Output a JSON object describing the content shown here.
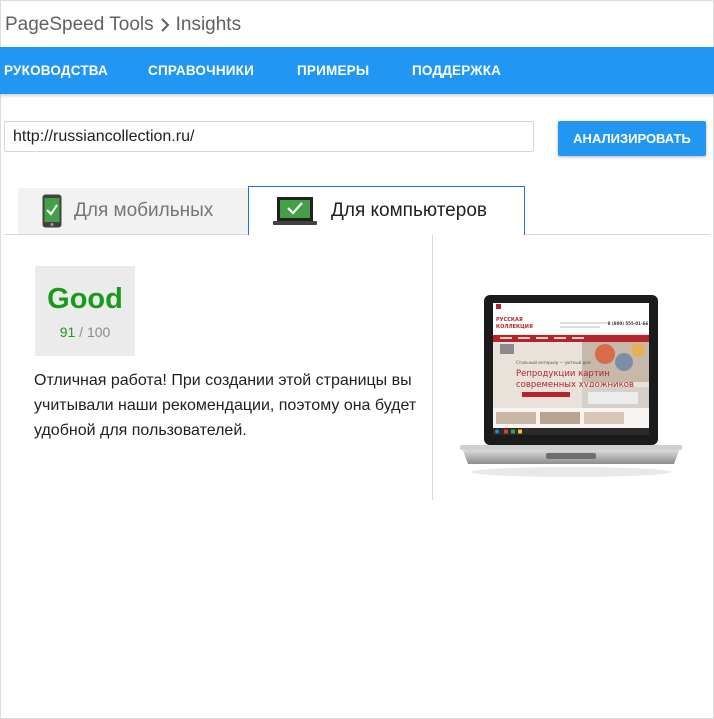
{
  "breadcrumb": {
    "root": "PageSpeed Tools",
    "current": "Insights"
  },
  "nav": {
    "items": [
      "РУКОВОДСТВА",
      "СПРАВОЧНИКИ",
      "ПРИМЕРЫ",
      "ПОДДЕРЖКА"
    ]
  },
  "analyze": {
    "url_value": "http://russiancollection.ru/",
    "button_label": "АНАЛИЗИРОВАТЬ"
  },
  "tabs": {
    "mobile_label": "Для мобильных",
    "desktop_label": "Для компьютеров",
    "active": "desktop"
  },
  "result": {
    "grade": "Good",
    "score": "91",
    "max": "100",
    "summary": "Отличная работа! При создании этой страницы вы учитывали наши рекомендации, поэтому она будет удобной для пользователей."
  },
  "preview": {
    "brand_line1": "РУССКАЯ",
    "brand_line2": "КОЛЛЕКЦИЯ",
    "phone": "8 (800) 555-01-66",
    "tagline": "Стильный интерьер — уютный дом",
    "headline_line1": "Репродукции картин",
    "headline_line2": "современных художников"
  },
  "colors": {
    "nav_bg": "#2196f3",
    "good_green": "#1a9a1a",
    "brand_red": "#b3252a"
  }
}
